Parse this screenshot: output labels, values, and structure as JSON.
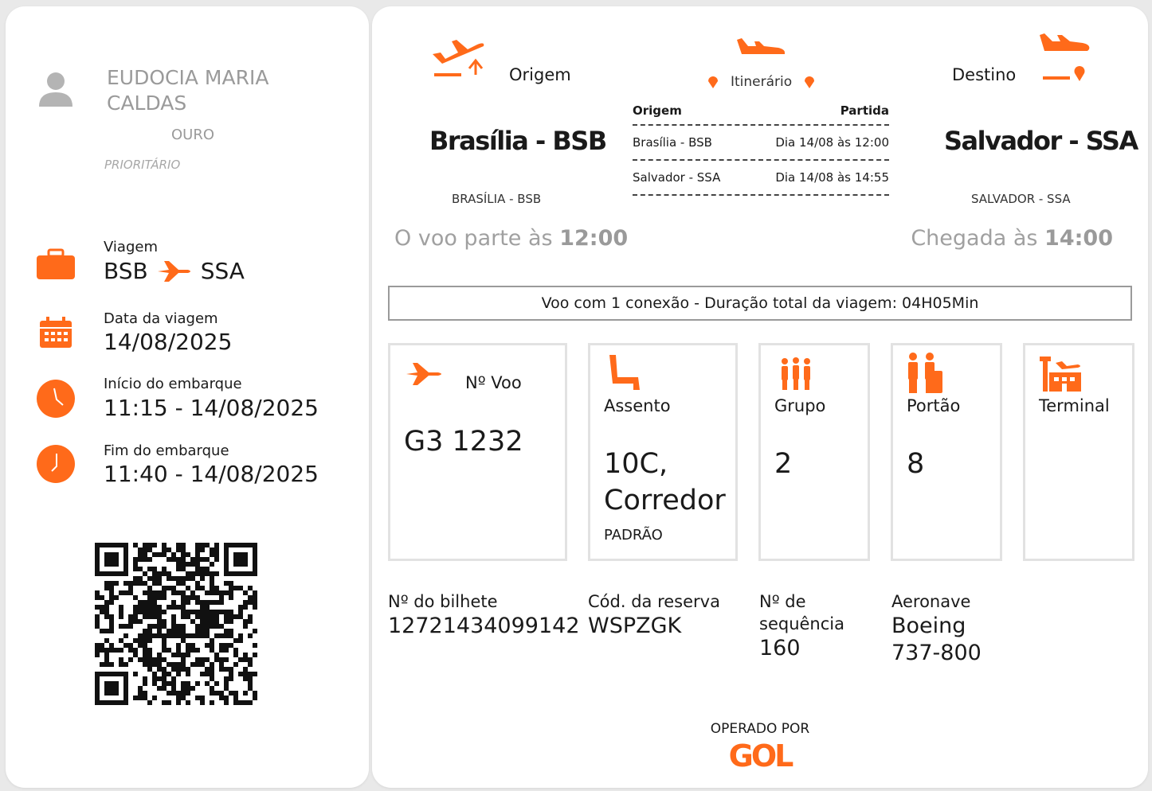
{
  "passenger": {
    "name_line1": "EUDOCIA MARIA",
    "name_line2": "CALDAS",
    "tier": "OURO",
    "priority": "PRIORITÁRIO"
  },
  "trip": {
    "label": "Viagem",
    "from": "BSB",
    "to": "SSA"
  },
  "travel_date": {
    "label": "Data da viagem",
    "value": "14/08/2025"
  },
  "boarding_start": {
    "label": "Início do embarque",
    "value": "11:15 - 14/08/2025"
  },
  "boarding_end": {
    "label": "Fim do embarque",
    "value": "11:40 - 14/08/2025"
  },
  "origin": {
    "title": "Origem",
    "city": "Brasília - BSB",
    "city_caps": "BRASÍLIA - BSB"
  },
  "destination": {
    "title": "Destino",
    "city": "Salvador - SSA",
    "city_caps": "SALVADOR - SSA"
  },
  "itinerary": {
    "title": "Itinerário",
    "col_origin": "Origem",
    "col_departure": "Partida",
    "rows": [
      {
        "origin": "Brasília - BSB",
        "departure": "Dia 14/08 às 12:00"
      },
      {
        "origin": "Salvador - SSA",
        "departure": "Dia 14/08 às 14:55"
      }
    ]
  },
  "departure_time": {
    "prefix": "O voo parte às ",
    "time": "12:00"
  },
  "arrival_time": {
    "prefix": "Chegada às ",
    "time": "14:00"
  },
  "connection": "Voo com 1 conexão - Duração total da viagem: 04H05Min",
  "flight": {
    "label": "Nº Voo",
    "value": "G3 1232"
  },
  "seat": {
    "label": "Assento",
    "value_line1": "10C,",
    "value_line2": "Corredor",
    "class": "PADRÃO"
  },
  "group": {
    "label": "Grupo",
    "value": "2"
  },
  "gate": {
    "label": "Portão",
    "value": "8"
  },
  "terminal": {
    "label": "Terminal",
    "value": ""
  },
  "ticket": {
    "label": "Nº do bilhete",
    "value": "12721434099142"
  },
  "booking": {
    "label": "Cód. da reserva",
    "value": "WSPZGK"
  },
  "sequence": {
    "label_line1": "Nº de",
    "label_line2": "sequência",
    "value": "160"
  },
  "aircraft": {
    "label": "Aeronave",
    "value_line1": "Boeing",
    "value_line2": "737-800"
  },
  "operator": {
    "label": "OPERADO POR",
    "brand": "GOL"
  },
  "colors": {
    "accent": "#ff6a1a",
    "muted": "#9a9a9a"
  },
  "icons": [
    "person-icon",
    "suitcase-icon",
    "plane-icon",
    "calendar-icon",
    "clock-icon",
    "takeoff-icon",
    "landing-icon",
    "location-pin-icon",
    "seat-icon",
    "group-icon",
    "gate-icon",
    "terminal-icon",
    "qr-code"
  ]
}
